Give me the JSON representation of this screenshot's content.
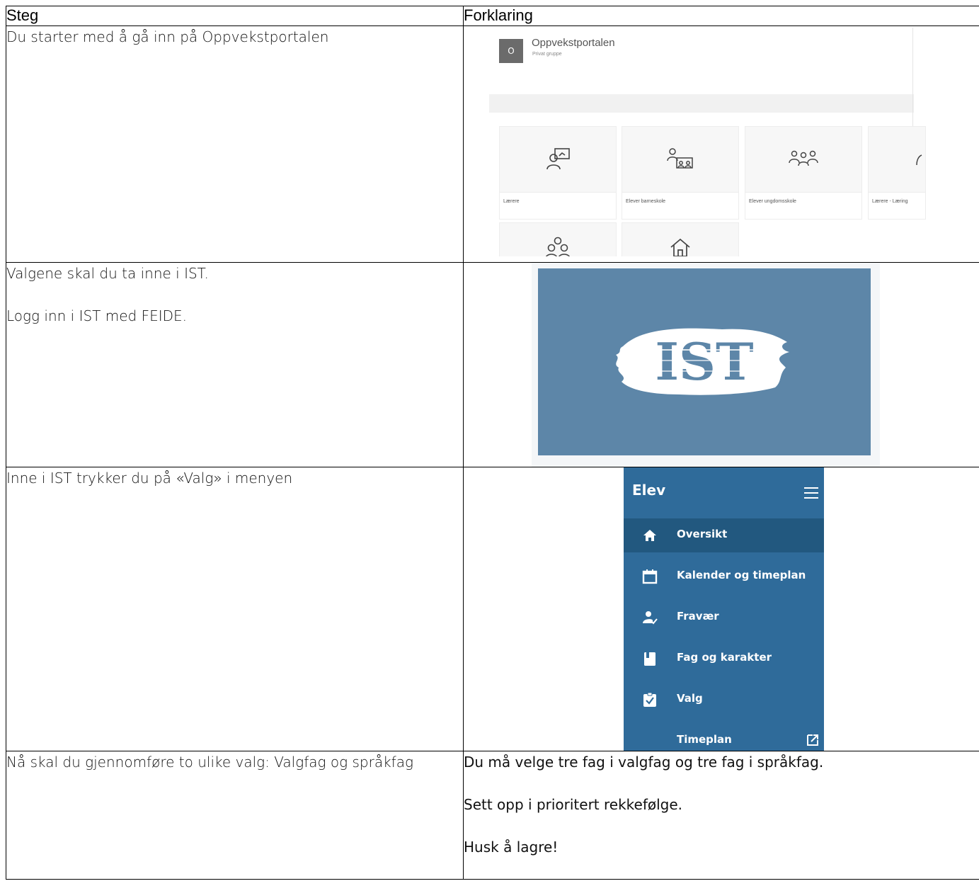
{
  "table": {
    "headers": {
      "step": "Steg",
      "explanation": "Forklaring"
    }
  },
  "rows": [
    {
      "step_lines": [
        "Du starter med å gå inn på Oppvekstportalen"
      ]
    },
    {
      "step_lines": [
        "Valgene skal du ta inne i IST.",
        "Logg inn i IST med FEIDE."
      ]
    },
    {
      "step_lines": [
        "Inne i IST trykker du på «Valg» i menyen"
      ]
    },
    {
      "step_lines": [
        "Nå skal du gjennomføre to ulike valg: Valgfag og språkfag"
      ],
      "explanation_lines": [
        "Du må velge tre fag i valgfag og tre fag i språkfag.",
        "Sett opp i prioritert rekkefølge.",
        "Husk å lagre!"
      ]
    }
  ],
  "portal": {
    "logo_letter": "O",
    "title": "Oppvekstportalen",
    "subtitle": "Privat gruppe",
    "tiles": [
      {
        "label": "Lærere",
        "icon": "teacher-board-icon"
      },
      {
        "label": "Elever barneskole",
        "icon": "students-desks-icon"
      },
      {
        "label": "Elever ungdomsskole",
        "icon": "group-people-icon"
      },
      {
        "label": "Lærere - Læring",
        "icon": "person-icon"
      },
      {
        "label": "",
        "icon": "three-people-icon"
      },
      {
        "label": "",
        "icon": "home-icon"
      }
    ]
  },
  "ist": {
    "logo_text": "IST",
    "bg_color": "#5d86a8"
  },
  "menu": {
    "title": "Elev",
    "bg_color": "#2f6b9a",
    "active_color": "#22587f",
    "items": [
      {
        "label": "Oversikt",
        "icon": "home-icon",
        "active": true
      },
      {
        "label": "Kalender og timeplan",
        "icon": "calendar-icon"
      },
      {
        "label": "Fravær",
        "icon": "absence-person-check-icon"
      },
      {
        "label": "Fag og karakter",
        "icon": "book-icon"
      },
      {
        "label": "Valg",
        "icon": "clipboard-check-icon"
      },
      {
        "label": "Timeplan",
        "icon": "external-link-icon"
      }
    ]
  }
}
